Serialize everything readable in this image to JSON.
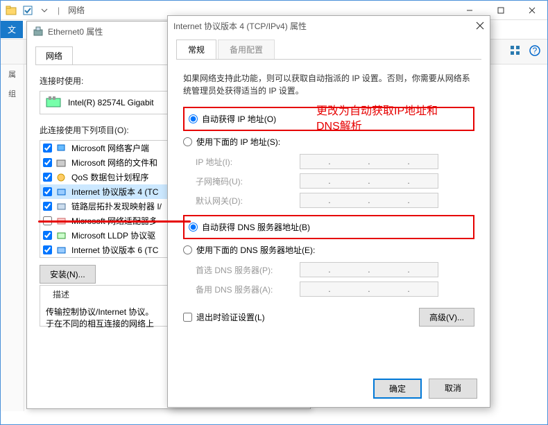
{
  "explorer": {
    "title": "网络",
    "ribbon": {
      "file": "文"
    },
    "left_items": [
      "属",
      "组"
    ]
  },
  "ethernet_dialog": {
    "title": "Ethernet0 属性",
    "tabs": {
      "network": "网络"
    },
    "connect_using_label": "连接时使用:",
    "adapter": "Intel(R) 82574L Gigabit",
    "items_label": "此连接使用下列项目(O):",
    "items": [
      {
        "checked": true,
        "label": "Microsoft 网络客户端"
      },
      {
        "checked": true,
        "label": "Microsoft 网络的文件和"
      },
      {
        "checked": true,
        "label": "QoS 数据包计划程序"
      },
      {
        "checked": true,
        "label": "Internet 协议版本 4 (TC",
        "selected": true
      },
      {
        "checked": true,
        "label": "链路层拓扑发现映射器 I/"
      },
      {
        "checked": false,
        "label": "Microsoft 网络适配器多"
      },
      {
        "checked": true,
        "label": "Microsoft LLDP 协议驱"
      },
      {
        "checked": true,
        "label": "Internet 协议版本 6 (TC"
      }
    ],
    "install_btn": "安装(N)...",
    "desc_label": "描述",
    "desc_text1": "传输控制协议/Internet 协议。",
    "desc_text2": "于在不同的相互连接的网络上"
  },
  "ipv4_dialog": {
    "title": "Internet 协议版本 4 (TCP/IPv4) 属性",
    "tabs": {
      "general": "常规",
      "alternate": "备用配置"
    },
    "help": "如果网络支持此功能，则可以获取自动指派的 IP 设置。否则，你需要从网络系统管理员处获得适当的 IP 设置。",
    "auto_ip": "自动获得 IP 地址(O)",
    "manual_ip": "使用下面的 IP 地址(S):",
    "ip_addr_label": "IP 地址(I):",
    "subnet_label": "子网掩码(U):",
    "gateway_label": "默认网关(D):",
    "auto_dns": "自动获得 DNS 服务器地址(B)",
    "manual_dns": "使用下面的 DNS 服务器地址(E):",
    "pref_dns_label": "首选 DNS 服务器(P):",
    "alt_dns_label": "备用 DNS 服务器(A):",
    "validate_label": "退出时验证设置(L)",
    "advanced_btn": "高级(V)...",
    "ok_btn": "确定",
    "cancel_btn": "取消"
  },
  "annotation": "更改为自动获取IP地址和DNS解析"
}
